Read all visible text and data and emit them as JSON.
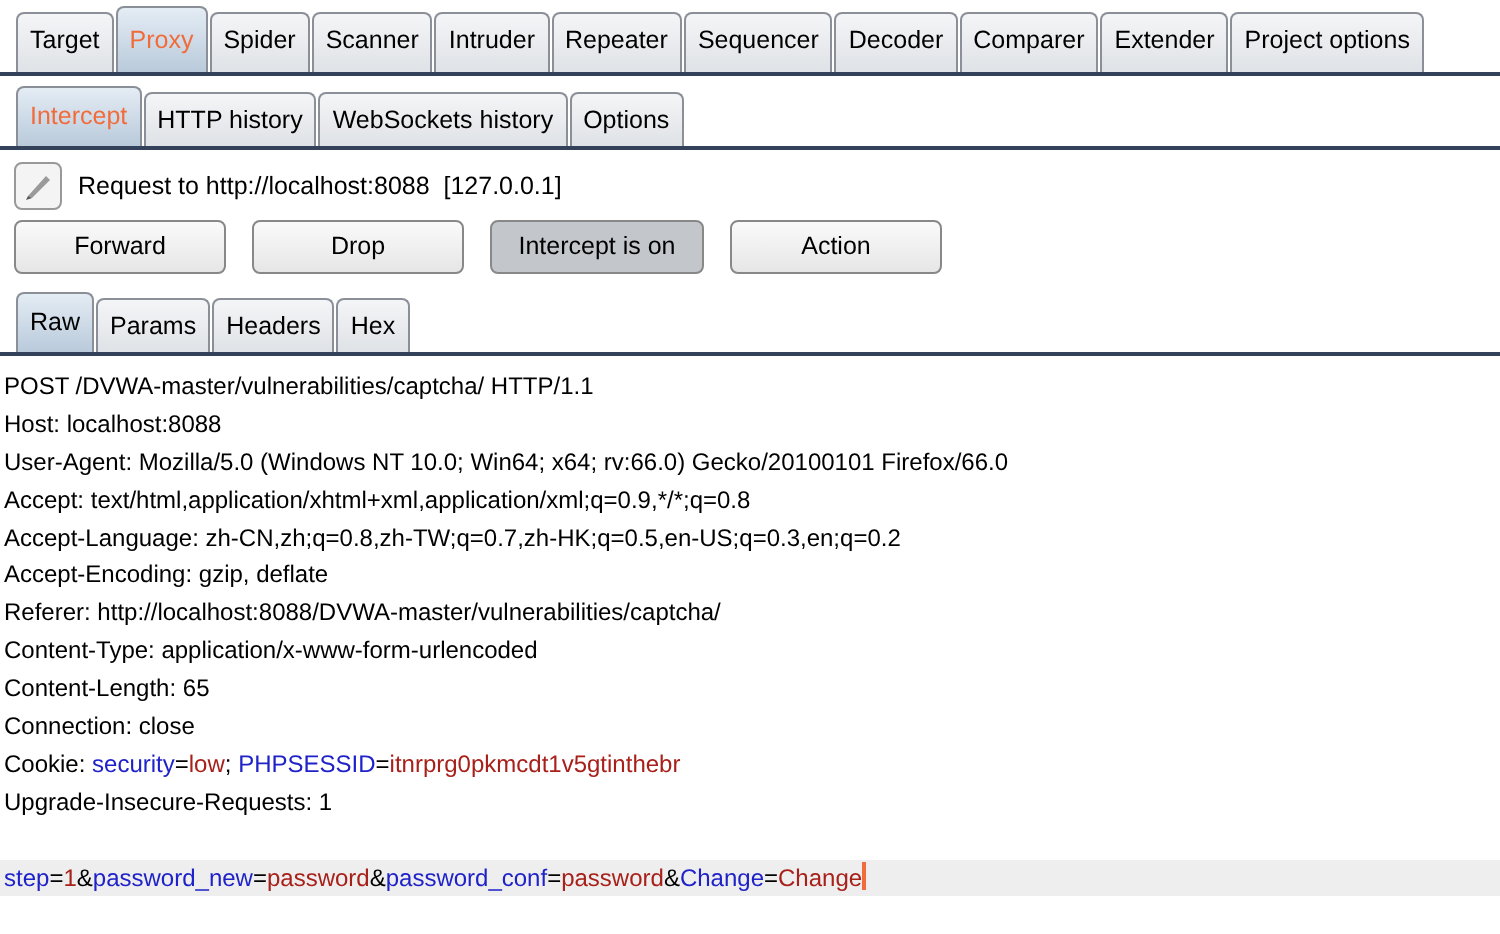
{
  "main_tabs": [
    {
      "label": "Target",
      "selected": false
    },
    {
      "label": "Proxy",
      "selected": true
    },
    {
      "label": "Spider",
      "selected": false
    },
    {
      "label": "Scanner",
      "selected": false
    },
    {
      "label": "Intruder",
      "selected": false
    },
    {
      "label": "Repeater",
      "selected": false
    },
    {
      "label": "Sequencer",
      "selected": false
    },
    {
      "label": "Decoder",
      "selected": false
    },
    {
      "label": "Comparer",
      "selected": false
    },
    {
      "label": "Extender",
      "selected": false
    },
    {
      "label": "Project options",
      "selected": false
    }
  ],
  "proxy_tabs": [
    {
      "label": "Intercept",
      "selected": true
    },
    {
      "label": "HTTP history",
      "selected": false
    },
    {
      "label": "WebSockets history",
      "selected": false
    },
    {
      "label": "Options",
      "selected": false
    }
  ],
  "request_info": "Request to http://localhost:8088  [127.0.0.1]",
  "buttons": [
    {
      "label": "Forward",
      "pressed": false
    },
    {
      "label": "Drop",
      "pressed": false
    },
    {
      "label": "Intercept is on",
      "pressed": true
    },
    {
      "label": "Action",
      "pressed": false
    }
  ],
  "editor_tabs": [
    {
      "label": "Raw",
      "selected": true
    },
    {
      "label": "Params",
      "selected": false
    },
    {
      "label": "Headers",
      "selected": false
    },
    {
      "label": "Hex",
      "selected": false
    }
  ],
  "request_lines": [
    {
      "current": false,
      "segments": [
        {
          "kind": "plain",
          "text": "POST /DVWA-master/vulnerabilities/captcha/ HTTP/1.1"
        }
      ]
    },
    {
      "current": false,
      "segments": [
        {
          "kind": "plain",
          "text": "Host: localhost:8088"
        }
      ]
    },
    {
      "current": false,
      "segments": [
        {
          "kind": "plain",
          "text": "User-Agent: Mozilla/5.0 (Windows NT 10.0; Win64; x64; rv:66.0) Gecko/20100101 Firefox/66.0"
        }
      ]
    },
    {
      "current": false,
      "segments": [
        {
          "kind": "plain",
          "text": "Accept: text/html,application/xhtml+xml,application/xml;q=0.9,*/*;q=0.8"
        }
      ]
    },
    {
      "current": false,
      "segments": [
        {
          "kind": "plain",
          "text": "Accept-Language: zh-CN,zh;q=0.8,zh-TW;q=0.7,zh-HK;q=0.5,en-US;q=0.3,en;q=0.2"
        }
      ]
    },
    {
      "current": false,
      "segments": [
        {
          "kind": "plain",
          "text": "Accept-Encoding: gzip, deflate"
        }
      ]
    },
    {
      "current": false,
      "segments": [
        {
          "kind": "plain",
          "text": "Referer: http://localhost:8088/DVWA-master/vulnerabilities/captcha/"
        }
      ]
    },
    {
      "current": false,
      "segments": [
        {
          "kind": "plain",
          "text": "Content-Type: application/x-www-form-urlencoded"
        }
      ]
    },
    {
      "current": false,
      "segments": [
        {
          "kind": "plain",
          "text": "Content-Length: 65"
        }
      ]
    },
    {
      "current": false,
      "segments": [
        {
          "kind": "plain",
          "text": "Connection: close"
        }
      ]
    },
    {
      "current": false,
      "segments": [
        {
          "kind": "plain",
          "text": "Cookie: "
        },
        {
          "kind": "name",
          "text": "security"
        },
        {
          "kind": "plain",
          "text": "="
        },
        {
          "kind": "value",
          "text": "low"
        },
        {
          "kind": "plain",
          "text": "; "
        },
        {
          "kind": "name",
          "text": "PHPSESSID"
        },
        {
          "kind": "plain",
          "text": "="
        },
        {
          "kind": "value",
          "text": "itnrprg0pkmcdt1v5gtinthebr"
        }
      ]
    },
    {
      "current": false,
      "segments": [
        {
          "kind": "plain",
          "text": "Upgrade-Insecure-Requests: 1"
        }
      ]
    },
    {
      "current": false
    },
    {
      "current": true,
      "segments": [
        {
          "kind": "name",
          "text": "step"
        },
        {
          "kind": "plain",
          "text": "="
        },
        {
          "kind": "value",
          "text": "1"
        },
        {
          "kind": "plain",
          "text": "&"
        },
        {
          "kind": "name",
          "text": "password_new"
        },
        {
          "kind": "plain",
          "text": "="
        },
        {
          "kind": "value",
          "text": "password"
        },
        {
          "kind": "plain",
          "text": "&"
        },
        {
          "kind": "name",
          "text": "password_conf"
        },
        {
          "kind": "plain",
          "text": "="
        },
        {
          "kind": "value",
          "text": "password"
        },
        {
          "kind": "plain",
          "text": "&"
        },
        {
          "kind": "name",
          "text": "Change"
        },
        {
          "kind": "plain",
          "text": "="
        },
        {
          "kind": "value",
          "text": "Change"
        }
      ]
    }
  ]
}
